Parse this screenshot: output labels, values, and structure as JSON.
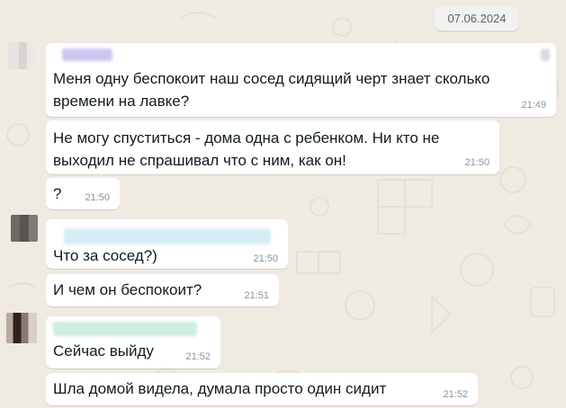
{
  "date": "07.06.2024",
  "messages": [
    {
      "text_lines": [
        "Меня одну беспокоит наш сосед сидящий черт знает сколько",
        "времени на лавке?"
      ],
      "time": "21:49"
    },
    {
      "text_lines": [
        "Не могу спуститься - дома одна с ребенком. Ни кто не",
        "выходил не спрашивал что с ним, как он!"
      ],
      "time": "21:50"
    },
    {
      "text": "?",
      "time": "21:50"
    },
    {
      "text": "Что за сосед?)",
      "time": "21:50"
    },
    {
      "text": "И чем он беспокоит?",
      "time": "21:51"
    },
    {
      "text": "Сейчас выйду",
      "time": "21:52"
    },
    {
      "text": "Шла домой видела, думала просто один сидит",
      "time": "21:52"
    }
  ]
}
